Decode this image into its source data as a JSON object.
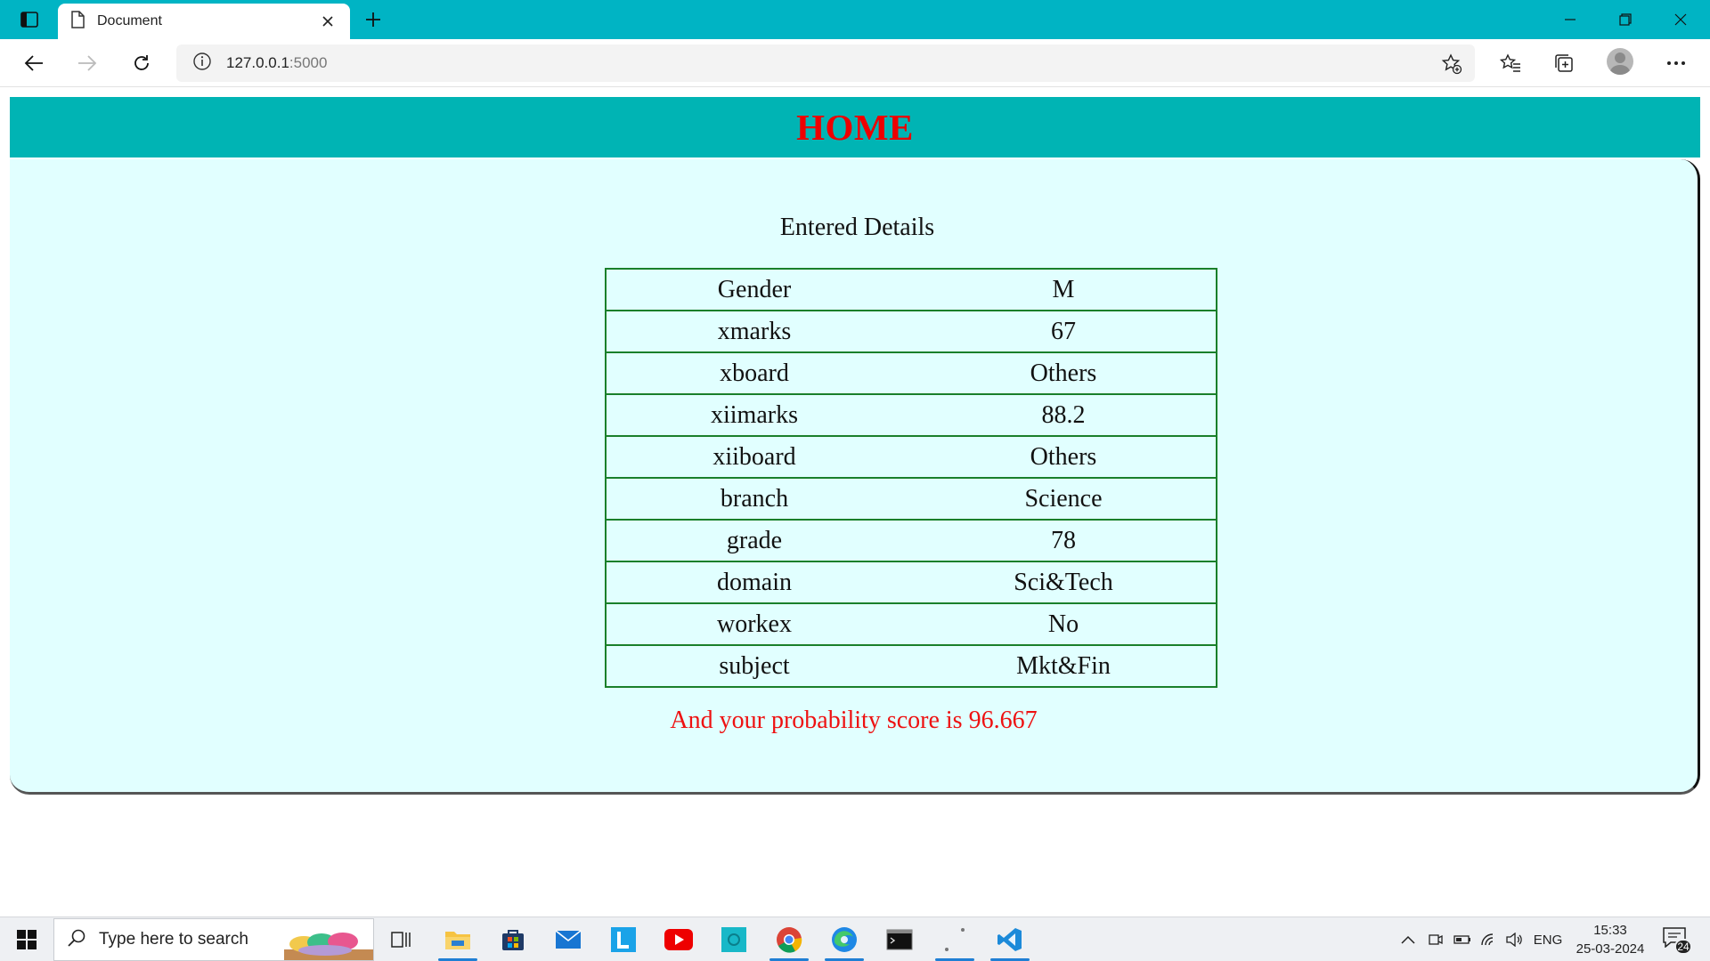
{
  "browser": {
    "tab_title": "Document",
    "url_host": "127.0.0.1",
    "url_port": ":5000"
  },
  "page": {
    "header_title": "HOME",
    "details_title": "Entered Details",
    "details": [
      {
        "label": "Gender",
        "value": "M"
      },
      {
        "label": "xmarks",
        "value": "67"
      },
      {
        "label": "xboard",
        "value": "Others"
      },
      {
        "label": "xiimarks",
        "value": "88.2"
      },
      {
        "label": "xiiboard",
        "value": "Others"
      },
      {
        "label": "branch",
        "value": "Science"
      },
      {
        "label": "grade",
        "value": "78"
      },
      {
        "label": "domain",
        "value": "Sci&Tech"
      },
      {
        "label": "workex",
        "value": "No"
      },
      {
        "label": "subject",
        "value": "Mkt&Fin"
      }
    ],
    "score_text": "And your probability score is 96.667"
  },
  "taskbar": {
    "search_placeholder": "Type here to search",
    "apps": [
      "file-explorer-icon",
      "store-icon",
      "mail-icon",
      "l-app-icon",
      "youtube-icon",
      "app-icon",
      "chrome-icon",
      "edge-icon",
      "terminal-icon",
      "jupyter-icon",
      "vscode-icon"
    ],
    "language": "ENG",
    "time": "15:33",
    "date": "25-03-2024",
    "notification_count": "24"
  },
  "colors": {
    "tabbar": "#00b4c4",
    "header_bg": "#00b4b4",
    "header_text": "#ee0000",
    "card_bg": "#e1ffff",
    "table_border": "#1a7f2a",
    "score_text": "#ee1111"
  }
}
